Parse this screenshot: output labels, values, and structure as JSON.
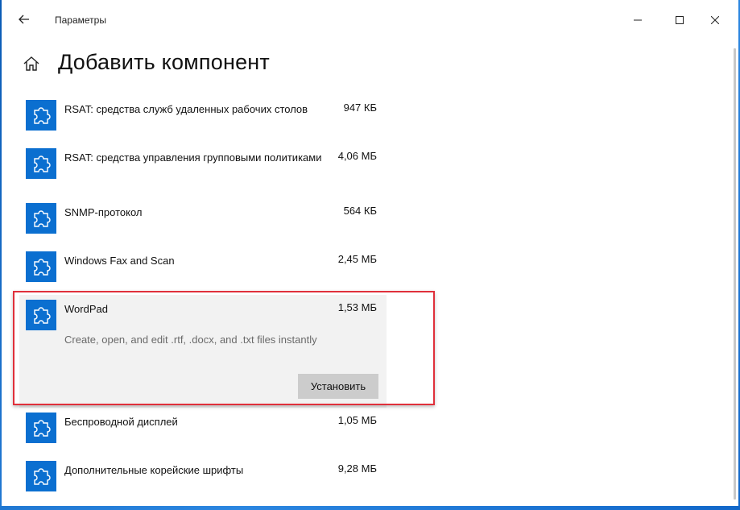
{
  "window": {
    "title": "Параметры"
  },
  "page": {
    "title": "Добавить компонент"
  },
  "features": [
    {
      "name": "RSAT: средства служб удаленных рабочих столов",
      "size": "947 КБ"
    },
    {
      "name": "RSAT: средства управления групповыми политиками",
      "size": "4,06 МБ"
    },
    {
      "name": "SNMP-протокол",
      "size": "564 КБ"
    },
    {
      "name": "Windows Fax and Scan",
      "size": "2,45 МБ"
    },
    {
      "name": "WordPad",
      "size": "1,53 МБ",
      "description": "Create, open, and edit .rtf, .docx, and .txt files instantly",
      "install_label": "Установить"
    },
    {
      "name": "Беспроводной дисплей",
      "size": "1,05 МБ"
    },
    {
      "name": "Дополнительные корейские шрифты",
      "size": "9,28 МБ"
    }
  ],
  "colors": {
    "accent": "#0b6fd0",
    "highlight": "#e0303b",
    "expanded_bg": "#f2f2f2",
    "button_bg": "#cccccc"
  },
  "icons": {
    "back": "back-arrow-icon",
    "home": "home-icon",
    "feature": "puzzle-piece-icon",
    "minimize": "minimize-icon",
    "maximize": "maximize-icon",
    "close": "close-icon"
  }
}
